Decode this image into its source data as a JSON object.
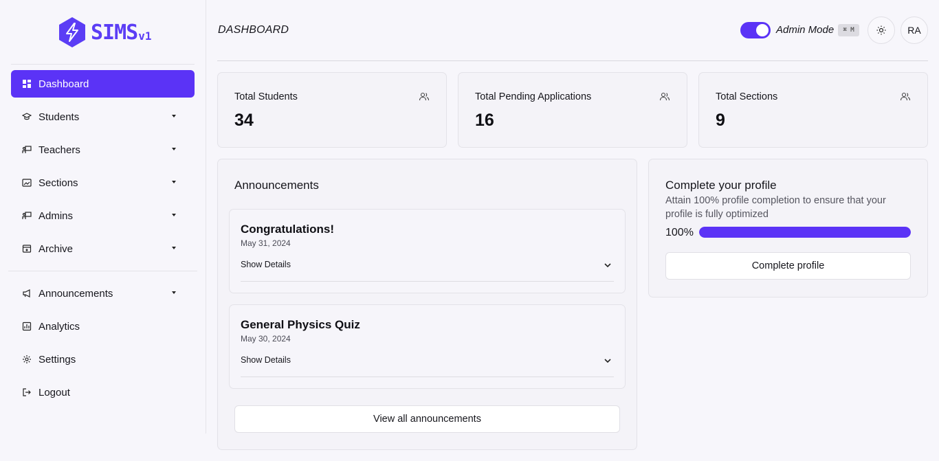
{
  "brand": {
    "name": "SIMS",
    "version": "v1",
    "accent": "#5b33f6"
  },
  "sidebar": {
    "items": [
      {
        "label": "Dashboard",
        "icon": "dashboard-icon",
        "active": true,
        "has_caret": false
      },
      {
        "label": "Students",
        "icon": "students-icon",
        "active": false,
        "has_caret": true
      },
      {
        "label": "Teachers",
        "icon": "teachers-icon",
        "active": false,
        "has_caret": true
      },
      {
        "label": "Sections",
        "icon": "sections-icon",
        "active": false,
        "has_caret": true
      },
      {
        "label": "Admins",
        "icon": "admins-icon",
        "active": false,
        "has_caret": true
      },
      {
        "label": "Archive",
        "icon": "archive-icon",
        "active": false,
        "has_caret": true
      }
    ],
    "secondary_items": [
      {
        "label": "Announcements",
        "icon": "megaphone-icon",
        "has_caret": true
      },
      {
        "label": "Analytics",
        "icon": "analytics-icon",
        "has_caret": false
      },
      {
        "label": "Settings",
        "icon": "gear-icon",
        "has_caret": false
      },
      {
        "label": "Logout",
        "icon": "logout-icon",
        "has_caret": false
      }
    ]
  },
  "header": {
    "title": "DASHBOARD",
    "admin_mode_label": "Admin Mode",
    "admin_mode_on": true,
    "shortcut": "⌘ M",
    "theme_icon": "sun-icon",
    "avatar_initials": "RA"
  },
  "stats": [
    {
      "label": "Total Students",
      "value": "34",
      "icon": "users-icon"
    },
    {
      "label": "Total Pending Applications",
      "value": "16",
      "icon": "users-icon"
    },
    {
      "label": "Total Sections",
      "value": "9",
      "icon": "users-icon"
    }
  ],
  "announcements": {
    "title": "Announcements",
    "items": [
      {
        "title": "Congratulations!",
        "date": "May 31, 2024",
        "toggle_label": "Show Details"
      },
      {
        "title": "General Physics Quiz",
        "date": "May 30, 2024",
        "toggle_label": "Show Details"
      }
    ],
    "view_all_label": "View all announcements"
  },
  "profile": {
    "title": "Complete your profile",
    "description": "Attain 100% profile completion to ensure that your profile is fully optimized",
    "percent_label": "100%",
    "progress": 1.0,
    "button_label": "Complete profile"
  }
}
